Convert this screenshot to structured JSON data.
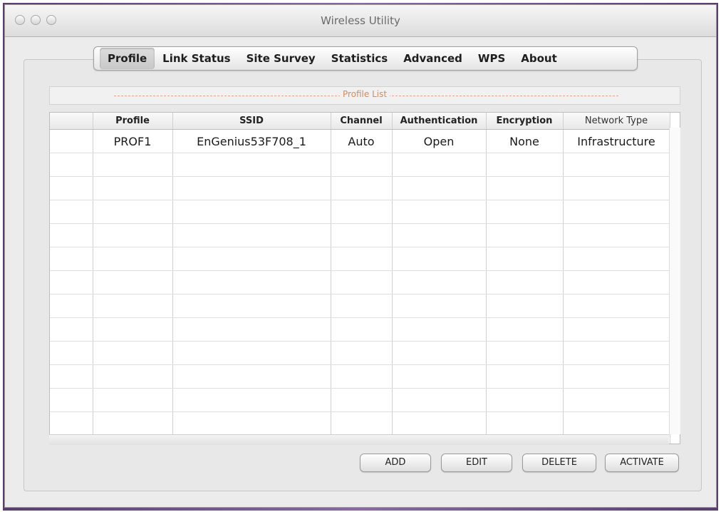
{
  "window": {
    "title": "Wireless Utility"
  },
  "tabs": [
    {
      "label": "Profile",
      "active": true
    },
    {
      "label": "Link Status"
    },
    {
      "label": "Site Survey"
    },
    {
      "label": "Statistics"
    },
    {
      "label": "Advanced"
    },
    {
      "label": "WPS"
    },
    {
      "label": "About"
    }
  ],
  "profile_list": {
    "title": "Profile List",
    "columns": [
      "",
      "Profile",
      "SSID",
      "Channel",
      "Authentication",
      "Encryption",
      "Network Type"
    ],
    "rows": [
      [
        "",
        "PROF1",
        "EnGenius53F708_1",
        "Auto",
        "Open",
        "None",
        "Infrastructure"
      ]
    ]
  },
  "buttons": {
    "add": "ADD",
    "edit": "EDIT",
    "delete": "DELETE",
    "activate": "ACTIVATE"
  }
}
